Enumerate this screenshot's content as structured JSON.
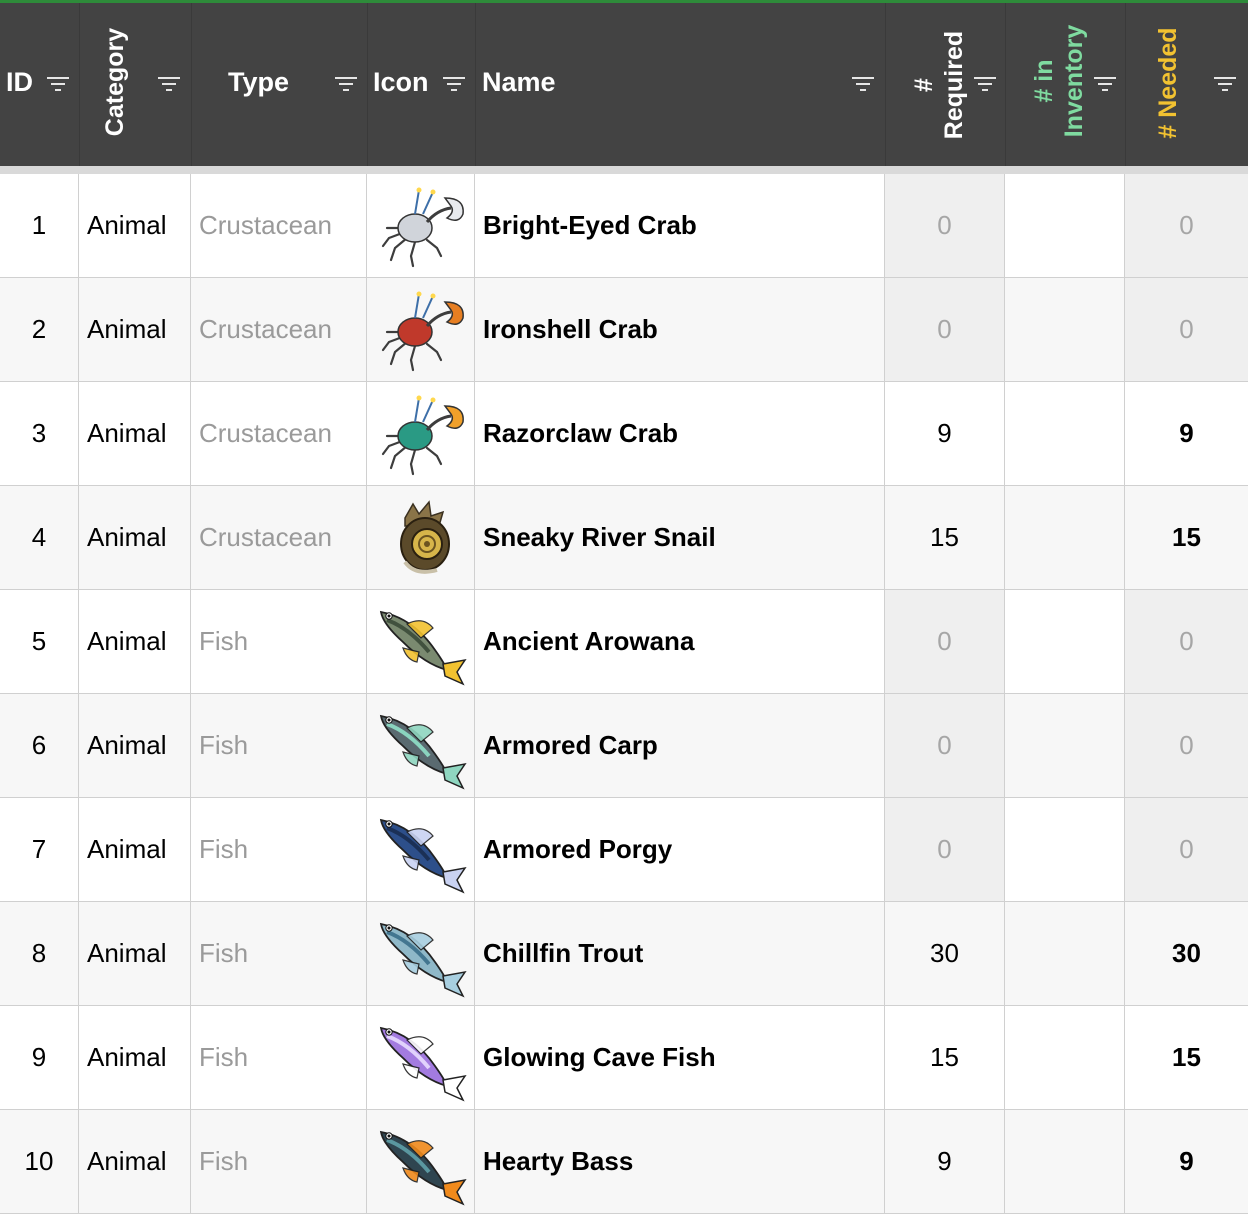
{
  "columns": {
    "id": "ID",
    "category": "Category",
    "type": "Type",
    "icon": "Icon",
    "name": "Name",
    "required": "# Required",
    "inventory": "# in Inventory",
    "needed": "# Needed"
  },
  "colors": {
    "header_bg": "#434343",
    "inventory_header": "#7fdba0",
    "needed_header": "#f2c231",
    "type_text": "#9a9a9a",
    "zero_cell_bg": "#efefef"
  },
  "rows": [
    {
      "id": "1",
      "category": "Animal",
      "type": "Crustacean",
      "icon": "crab-gray-icon",
      "name": "Bright-Eyed Crab",
      "required": "0",
      "inventory": "",
      "needed": "0"
    },
    {
      "id": "2",
      "category": "Animal",
      "type": "Crustacean",
      "icon": "crab-red-icon",
      "name": "Ironshell Crab",
      "required": "0",
      "inventory": "",
      "needed": "0"
    },
    {
      "id": "3",
      "category": "Animal",
      "type": "Crustacean",
      "icon": "crab-teal-icon",
      "name": "Razorclaw Crab",
      "required": "9",
      "inventory": "",
      "needed": "9"
    },
    {
      "id": "4",
      "category": "Animal",
      "type": "Crustacean",
      "icon": "snail-icon",
      "name": "Sneaky River Snail",
      "required": "15",
      "inventory": "",
      "needed": "15"
    },
    {
      "id": "5",
      "category": "Animal",
      "type": "Fish",
      "icon": "arowana-icon",
      "name": "Ancient Arowana",
      "required": "0",
      "inventory": "",
      "needed": "0"
    },
    {
      "id": "6",
      "category": "Animal",
      "type": "Fish",
      "icon": "carp-icon",
      "name": "Armored Carp",
      "required": "0",
      "inventory": "",
      "needed": "0"
    },
    {
      "id": "7",
      "category": "Animal",
      "type": "Fish",
      "icon": "porgy-icon",
      "name": "Armored Porgy",
      "required": "0",
      "inventory": "",
      "needed": "0"
    },
    {
      "id": "8",
      "category": "Animal",
      "type": "Fish",
      "icon": "trout-icon",
      "name": "Chillfin Trout",
      "required": "30",
      "inventory": "",
      "needed": "30"
    },
    {
      "id": "9",
      "category": "Animal",
      "type": "Fish",
      "icon": "cave-fish-icon",
      "name": "Glowing Cave Fish",
      "required": "15",
      "inventory": "",
      "needed": "15"
    },
    {
      "id": "10",
      "category": "Animal",
      "type": "Fish",
      "icon": "bass-icon",
      "name": "Hearty Bass",
      "required": "9",
      "inventory": "",
      "needed": "9"
    }
  ]
}
